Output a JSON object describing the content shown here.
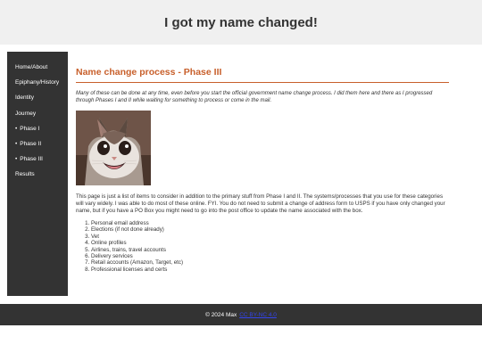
{
  "header": {
    "title": "I got my name changed!"
  },
  "sidebar": {
    "items": [
      {
        "label": "Home/About",
        "bullet": ""
      },
      {
        "label": "Epiphany/History",
        "bullet": ""
      },
      {
        "label": "Identity",
        "bullet": ""
      },
      {
        "label": "Journey",
        "bullet": ""
      },
      {
        "label": "Phase I",
        "bullet": "•"
      },
      {
        "label": "Phase II",
        "bullet": "•"
      },
      {
        "label": "Phase III",
        "bullet": "•"
      },
      {
        "label": "Results",
        "bullet": ""
      }
    ]
  },
  "main": {
    "title": "Name change process - Phase III",
    "intro": "Many of these can be done at any time, even before you start the official government name change process. I did them here and there as I progressed through Phases I and II while waiting for something to process or come in the mail.",
    "body": "This page is just a list of items to consider in addition to the primary stuff from Phase I and II. The systems/processes that you use for these categories will vary widely. I was able to do most of these online. FYI. You do not need to submit a change of address form to USPS if you have only changed your name, but if you have a PO Box you might need to go into the post office to update the name associated with the box.",
    "items": [
      "Personal email address",
      "Elections (if not done already)",
      "Vet",
      "Online profiles",
      "Airlines, trains, travel accounts",
      "Delivery services",
      "Retail accounts (Amazon, Target, etc)",
      "Professional licenses and certs"
    ]
  },
  "footer": {
    "copyright": "© 2024 Max",
    "license": "CC BY-NC 4.0"
  },
  "colors": {
    "accent": "#c8602c",
    "sidebar_bg": "#333333",
    "header_bg": "#f0f0f0",
    "link": "#3344ee"
  }
}
